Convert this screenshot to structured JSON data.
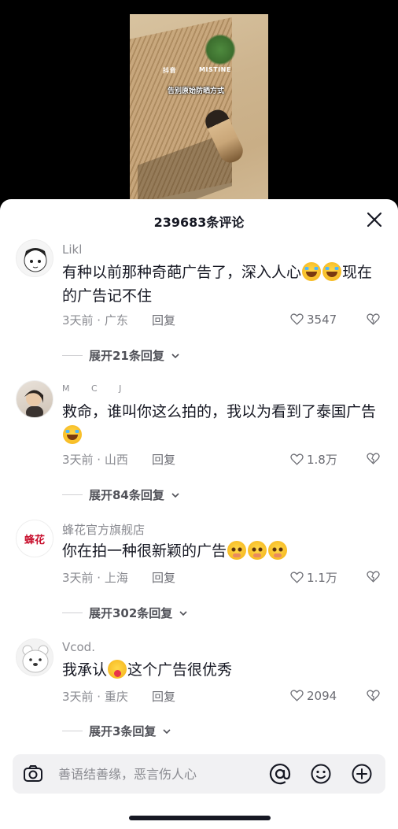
{
  "video": {
    "logo_text": "抖音",
    "brand_text": "MISTINE",
    "caption": "告别原始防晒方式"
  },
  "sheet": {
    "title": "239683条评论"
  },
  "comments": [
    {
      "user": "Likl",
      "text_before": "有种以前那种奇葩广告了，深入人心",
      "text_after": "现在的广告记不住",
      "time_location": "3天前 · 广东",
      "reply_label": "回复",
      "likes": "3547",
      "expand_label": "展开21条回复"
    },
    {
      "user": "M C J",
      "text_before": "救命，谁叫你这么拍的，我以为看到了泰国广告",
      "text_after": "",
      "time_location": "3天前 · 山西",
      "reply_label": "回复",
      "likes": "1.8万",
      "expand_label": "展开84条回复"
    },
    {
      "user": "蜂花官方旗舰店",
      "avatar_text": "蜂花",
      "text_before": "你在拍一种很新颖的广告",
      "text_after": "",
      "time_location": "3天前 · 上海",
      "reply_label": "回复",
      "likes": "1.1万",
      "expand_label": "展开302条回复"
    },
    {
      "user": "Vcod.",
      "text_before": "我承认",
      "text_after": "这个广告很优秀",
      "time_location": "3天前 · 重庆",
      "reply_label": "回复",
      "likes": "2094",
      "expand_label": "展开3条回复"
    }
  ],
  "input": {
    "placeholder": "善语结善缘，恶言伤人心"
  },
  "colors": {
    "text_primary": "#161823",
    "text_secondary": "#8a8b91",
    "brand_red": "#c8102e"
  }
}
